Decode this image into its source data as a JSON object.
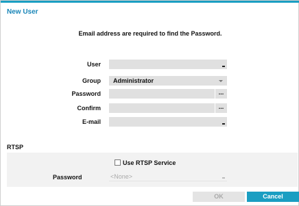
{
  "dialog": {
    "title": "New User"
  },
  "notice": "Email address are required to find the Password.",
  "form": {
    "user": {
      "label": "User",
      "value": ""
    },
    "group": {
      "label": "Group",
      "value": "Administrator"
    },
    "password": {
      "label": "Password",
      "value": "",
      "button": "..."
    },
    "confirm": {
      "label": "Confirm",
      "value": "",
      "button": "..."
    },
    "email": {
      "label": "E-mail",
      "value": ""
    }
  },
  "rtsp": {
    "section_title": "RTSP",
    "use_service_label": "Use RTSP Service",
    "use_service_checked": false,
    "password_label": "Password",
    "password_value": "<None>"
  },
  "buttons": {
    "ok": "OK",
    "cancel": "Cancel"
  },
  "colors": {
    "accent": "#1a9ec2",
    "title": "#1a86b8"
  },
  "icons": {
    "keyboard": "keyboard-icon",
    "dropdown": "chevron-down-icon"
  }
}
